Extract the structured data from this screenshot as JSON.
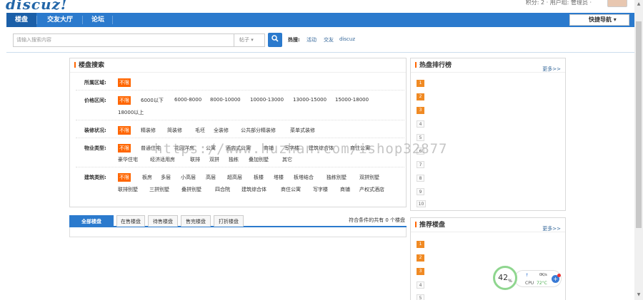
{
  "header": {
    "logo": "discuz!",
    "user_info": "积分: 2 · 用户组: 管理员 ·"
  },
  "nav": {
    "items": [
      {
        "label": "楼盘"
      },
      {
        "label": "交友大厅"
      },
      {
        "label": "论坛"
      }
    ],
    "quick_nav": "快捷导航"
  },
  "search": {
    "placeholder": "请输入搜索内容",
    "type": "帖子",
    "hot_label": "热搜:",
    "hot_terms": [
      "活动",
      "交友",
      "discuz"
    ]
  },
  "filter_panel": {
    "title": "楼盘搜索",
    "rows": [
      {
        "label": "所属区域:",
        "options": [
          "不限"
        ]
      },
      {
        "label": "价格区间:",
        "options": [
          "不限",
          "6000以下",
          "6000-8000",
          "8000-10000",
          "10000-13000",
          "13000-15000",
          "15000-18000",
          "18000以上"
        ]
      },
      {
        "label": "装修状况:",
        "options": [
          "不限",
          "精装修",
          "简装修",
          "毛坯",
          "全装修",
          "公共部分精装修",
          "菜单式装修"
        ]
      },
      {
        "label": "物业类型:",
        "options": [
          "不限",
          "普通住宅",
          "花园洋房",
          "公寓",
          "酒店式公寓",
          "商铺",
          "写字楼",
          "建筑综合体",
          "商住公寓",
          "豪华住宅",
          "经济适用房",
          "联排",
          "双拼",
          "独栋",
          "叠加别墅",
          "其它"
        ]
      },
      {
        "label": "建筑类别:",
        "options": [
          "不限",
          "板房",
          "多层",
          "小高层",
          "高层",
          "超高层",
          "板楼",
          "塔楼",
          "板塔结合",
          "独栋别墅",
          "双拼别墅",
          "联排别墅",
          "三拼别墅",
          "叠拼别墅",
          "四合院",
          "建筑综合体",
          "商住公寓",
          "写字楼",
          "商铺",
          "产权式酒店"
        ]
      }
    ]
  },
  "tabs": {
    "items": [
      {
        "label": "全部楼盘"
      },
      {
        "label": "在售楼盘"
      },
      {
        "label": "待售楼盘"
      },
      {
        "label": "售完楼盘"
      },
      {
        "label": "打折楼盘"
      }
    ],
    "result_text": "符合条件的共有 0 个楼盘"
  },
  "hot_rank": {
    "title": "热盘排行榜",
    "more": "更多>>",
    "ranks": [
      "1",
      "2",
      "3",
      "4",
      "5",
      "6",
      "7",
      "8",
      "9",
      "10"
    ]
  },
  "recommend": {
    "title": "推荐楼盘",
    "more": "更多>>",
    "ranks": [
      "1",
      "2",
      "3",
      "4",
      "5"
    ]
  },
  "watermark": "https://www.huzhan.com/ishop32877",
  "cpu_widget": {
    "percent": "42",
    "percent_unit": "%",
    "speed": "0K/s",
    "cpu_label": "CPU",
    "temp": "72°C"
  }
}
